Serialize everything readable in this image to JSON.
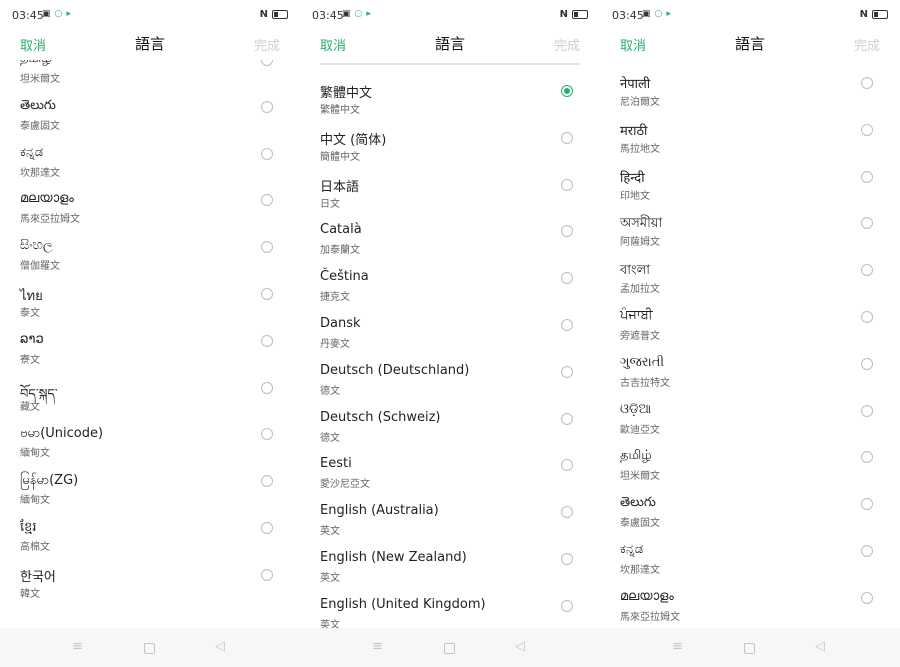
{
  "panels": [
    {
      "status": {
        "time": "03:45"
      },
      "header": {
        "cancel": "取消",
        "title": "語言",
        "done": "完成"
      },
      "items": [
        {
          "name": "தமிழ்",
          "sub": "坦米爾文",
          "selected": false
        },
        {
          "name": "తెలుగు",
          "sub": "泰盧固文",
          "selected": false
        },
        {
          "name": "ಕನ್ನಡ",
          "sub": "坎那達文",
          "selected": false
        },
        {
          "name": "മലയാളം",
          "sub": "馬來亞拉姆文",
          "selected": false
        },
        {
          "name": "සිංහල",
          "sub": "僧伽羅文",
          "selected": false
        },
        {
          "name": "ไทย",
          "sub": "泰文",
          "selected": false
        },
        {
          "name": "ລາວ",
          "sub": "寮文",
          "selected": false
        },
        {
          "name": "བོད་སྐད་",
          "sub": "藏文",
          "selected": false
        },
        {
          "name": "ဗမာ(Unicode)",
          "sub": "緬甸文",
          "selected": false
        },
        {
          "name": "မြန်မာ(ZG)",
          "sub": "緬甸文",
          "selected": false
        },
        {
          "name": "ខ្មែរ",
          "sub": "高棉文",
          "selected": false
        },
        {
          "name": "한국어",
          "sub": "韓文",
          "selected": false
        }
      ]
    },
    {
      "status": {
        "time": "03:45"
      },
      "header": {
        "cancel": "取消",
        "title": "語言",
        "done": "完成"
      },
      "items": [
        {
          "name": "繁體中文",
          "sub": "繁體中文",
          "selected": true
        },
        {
          "name": "中文 (简体)",
          "sub": "簡體中文",
          "selected": false
        },
        {
          "name": "日本語",
          "sub": "日文",
          "selected": false
        },
        {
          "name": "Català",
          "sub": "加泰蘭文",
          "selected": false
        },
        {
          "name": "Čeština",
          "sub": "捷克文",
          "selected": false
        },
        {
          "name": "Dansk",
          "sub": "丹麥文",
          "selected": false
        },
        {
          "name": "Deutsch (Deutschland)",
          "sub": "德文",
          "selected": false
        },
        {
          "name": "Deutsch (Schweiz)",
          "sub": "德文",
          "selected": false
        },
        {
          "name": "Eesti",
          "sub": "愛沙尼亞文",
          "selected": false
        },
        {
          "name": "English (Australia)",
          "sub": "英文",
          "selected": false
        },
        {
          "name": "English (New Zealand)",
          "sub": "英文",
          "selected": false
        },
        {
          "name": "English (United Kingdom)",
          "sub": "英文",
          "selected": false
        }
      ]
    },
    {
      "status": {
        "time": "03:45"
      },
      "header": {
        "cancel": "取消",
        "title": "語言",
        "done": "完成"
      },
      "items": [
        {
          "name": "नेपाली",
          "sub": "尼泊爾文",
          "selected": false
        },
        {
          "name": "मराठी",
          "sub": "馬拉地文",
          "selected": false
        },
        {
          "name": "हिन्दी",
          "sub": "印地文",
          "selected": false
        },
        {
          "name": "অসমীয়া",
          "sub": "阿薩姆文",
          "selected": false
        },
        {
          "name": "বাংলা",
          "sub": "孟加拉文",
          "selected": false
        },
        {
          "name": "ਪੰਜਾਬੀ",
          "sub": "旁遮普文",
          "selected": false
        },
        {
          "name": "ગુજરાતી",
          "sub": "古吉拉特文",
          "selected": false
        },
        {
          "name": "ଓଡ଼ିଆ",
          "sub": "歐迪亞文",
          "selected": false
        },
        {
          "name": "தமிழ்",
          "sub": "坦米爾文",
          "selected": false
        },
        {
          "name": "తెలుగు",
          "sub": "泰盧固文",
          "selected": false
        },
        {
          "name": "ಕನ್ನಡ",
          "sub": "坎那達文",
          "selected": false
        },
        {
          "name": "മലയാളം",
          "sub": "馬來亞拉姆文",
          "selected": false
        }
      ]
    }
  ],
  "icons": {
    "menu": "≡",
    "back": "◁"
  },
  "colors": {
    "accent": "#26b06c",
    "done_disabled": "#cfcfcf",
    "nav_bar": "#f7f7f7"
  }
}
